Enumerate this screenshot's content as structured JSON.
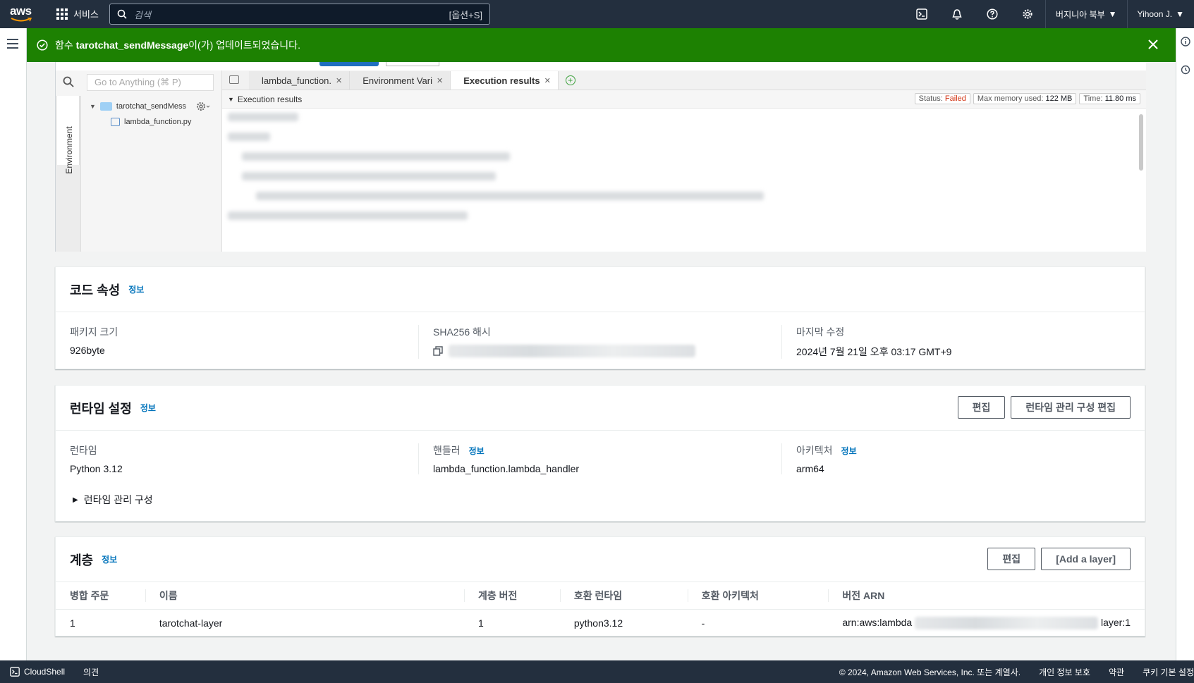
{
  "nav": {
    "logo": "aws",
    "services_label": "서비스",
    "search_placeholder": "검색",
    "search_shortcut": "[옵션+S]",
    "region": "버지니아 북부",
    "user": "Yihoon J."
  },
  "flash": {
    "prefix": "함수 ",
    "function_name": "tarotchat_sendMessage",
    "suffix": "이(가) 업데이트되었습니다."
  },
  "ide": {
    "goto_placeholder": "Go to Anything (⌘ P)",
    "env_label": "Environment",
    "tree": {
      "folder": "tarotchat_sendMess",
      "file": "lambda_function.py"
    },
    "tabs": [
      {
        "label": "lambda_function."
      },
      {
        "label": "Environment Vari"
      },
      {
        "label": "Execution results"
      }
    ],
    "results_label": "Execution results",
    "status_label": "Status:",
    "status_value": "Failed",
    "memory_label": "Max memory used:",
    "memory_value": "122 MB",
    "time_label": "Time:",
    "time_value": "11.80 ms"
  },
  "code_props": {
    "title": "코드 속성",
    "info": "정보",
    "package_size_label": "패키지 크기",
    "package_size_value": "926byte",
    "sha_label": "SHA256 해시",
    "modified_label": "마지막 수정",
    "modified_value": "2024년 7월 21일 오후 03:17 GMT+9"
  },
  "runtime": {
    "title": "런타임 설정",
    "info": "정보",
    "edit_button": "편집",
    "edit_mgmt_button": "런타임 관리 구성 편집",
    "runtime_label": "런타임",
    "runtime_value": "Python 3.12",
    "handler_label": "핸들러",
    "handler_info": "정보",
    "handler_value": "lambda_function.lambda_handler",
    "arch_label": "아키텍처",
    "arch_info": "정보",
    "arch_value": "arm64",
    "mgmt_toggle": "런타임 관리 구성"
  },
  "layers": {
    "title": "계층",
    "info": "정보",
    "edit_button": "편집",
    "add_button": "[Add a layer]",
    "columns": [
      "병합 주문",
      "이름",
      "계층 버전",
      "호환 런타임",
      "호환 아키텍처",
      "버전 ARN"
    ],
    "rows": [
      {
        "order": "1",
        "name": "tarotchat-layer",
        "version": "1",
        "runtime": "python3.12",
        "arch": "-",
        "arn_prefix": "arn:aws:lambda",
        "arn_suffix": "layer:1"
      }
    ]
  },
  "footer": {
    "cloudshell": "CloudShell",
    "feedback": "의견",
    "copyright": "© 2024, Amazon Web Services, Inc. 또는 계열사.",
    "privacy": "개인 정보 보호",
    "terms": "약관",
    "cookies": "쿠키 기본 설정"
  }
}
